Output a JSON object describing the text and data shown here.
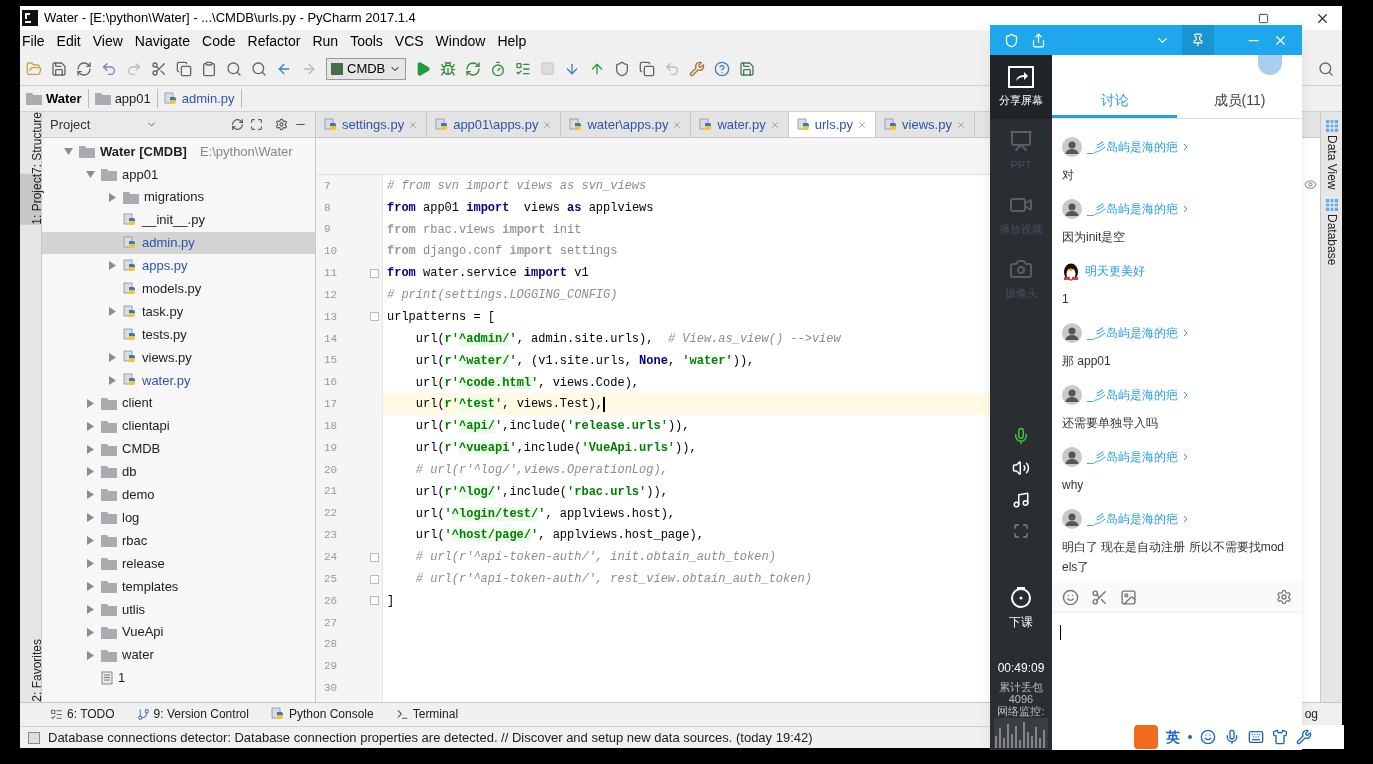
{
  "window": {
    "title": "Water - [E:\\python\\Water] - ...\\CMDB\\urls.py - PyCharm 2017.1.4"
  },
  "menu": [
    "File",
    "Edit",
    "View",
    "Navigate",
    "Code",
    "Refactor",
    "Run",
    "Tools",
    "VCS",
    "Window",
    "Help"
  ],
  "run_config": "CMDB",
  "breadcrumb": [
    {
      "label": "Water",
      "kind": "project"
    },
    {
      "label": "app01",
      "kind": "folder"
    },
    {
      "label": "admin.py",
      "kind": "python"
    }
  ],
  "side_tabs_left": [
    {
      "label": "7: Structure",
      "selected": false
    },
    {
      "label": "1: Project",
      "selected": true
    },
    {
      "label": "2: Favorites",
      "selected": false
    }
  ],
  "project_panel": {
    "title": "Project",
    "tree": [
      {
        "label": "Water [CMDB]",
        "path": "E:\\python\\Water",
        "kind": "project",
        "expanded": true,
        "selected": false,
        "changed": false,
        "children": [
          {
            "label": "app01",
            "kind": "folder",
            "expanded": true,
            "selected": false,
            "changed": false,
            "children": [
              {
                "label": "migrations",
                "kind": "folder",
                "expanded": false,
                "selected": false,
                "changed": false
              },
              {
                "label": "__init__.py",
                "kind": "python",
                "selected": false,
                "changed": false
              },
              {
                "label": "admin.py",
                "kind": "python",
                "selected": true,
                "changed": true
              },
              {
                "label": "apps.py",
                "kind": "python",
                "expanded": false,
                "selected": false,
                "changed": true
              },
              {
                "label": "models.py",
                "kind": "python",
                "selected": false,
                "changed": false
              },
              {
                "label": "task.py",
                "kind": "python",
                "expanded": false,
                "selected": false,
                "changed": false
              },
              {
                "label": "tests.py",
                "kind": "python",
                "selected": false,
                "changed": false
              },
              {
                "label": "views.py",
                "kind": "python",
                "expanded": false,
                "selected": false,
                "changed": false
              },
              {
                "label": "water.py",
                "kind": "python",
                "expanded": false,
                "selected": false,
                "changed": true
              }
            ]
          },
          {
            "label": "client",
            "kind": "folder",
            "expanded": false,
            "selected": false,
            "changed": false
          },
          {
            "label": "clientapi",
            "kind": "folder",
            "expanded": false,
            "selected": false,
            "changed": false
          },
          {
            "label": "CMDB",
            "kind": "folder",
            "expanded": false,
            "selected": false,
            "changed": false
          },
          {
            "label": "db",
            "kind": "folder",
            "expanded": false,
            "selected": false,
            "changed": false
          },
          {
            "label": "demo",
            "kind": "folder",
            "expanded": false,
            "selected": false,
            "changed": false
          },
          {
            "label": "log",
            "kind": "folder",
            "expanded": false,
            "selected": false,
            "changed": false
          },
          {
            "label": "rbac",
            "kind": "folder",
            "expanded": false,
            "selected": false,
            "changed": false
          },
          {
            "label": "release",
            "kind": "folder",
            "expanded": false,
            "selected": false,
            "changed": false
          },
          {
            "label": "templates",
            "kind": "folder",
            "expanded": false,
            "selected": false,
            "changed": false
          },
          {
            "label": "utlis",
            "kind": "folder",
            "expanded": false,
            "selected": false,
            "changed": false
          },
          {
            "label": "VueApi",
            "kind": "folder",
            "expanded": false,
            "selected": false,
            "changed": false
          },
          {
            "label": "water",
            "kind": "folder",
            "expanded": false,
            "selected": false,
            "changed": false
          },
          {
            "label": "1",
            "kind": "text",
            "selected": false,
            "changed": false
          }
        ]
      }
    ]
  },
  "editor_tabs": [
    {
      "label": "settings.py",
      "selected": false
    },
    {
      "label": "app01\\apps.py",
      "selected": false
    },
    {
      "label": "water\\apps.py",
      "selected": false
    },
    {
      "label": "water.py",
      "selected": false
    },
    {
      "label": "urls.py",
      "selected": true
    },
    {
      "label": "views.py",
      "selected": false
    }
  ],
  "code_lines": [
    {
      "number": "7",
      "current": false,
      "fold": false,
      "segments": [
        {
          "kind": "comment",
          "text": "# from svn import views as svn_views"
        }
      ]
    },
    {
      "number": "8",
      "current": false,
      "fold": false,
      "segments": [
        {
          "kind": "kw",
          "text": "from"
        },
        {
          "kind": "text",
          "text": " app01 "
        },
        {
          "kind": "kw",
          "text": "import"
        },
        {
          "kind": "text",
          "text": "  views "
        },
        {
          "kind": "kw",
          "text": "as"
        },
        {
          "kind": "text",
          "text": " applviews"
        }
      ]
    },
    {
      "number": "9",
      "current": false,
      "fold": false,
      "segments": [
        {
          "kind": "dimkw",
          "text": "from"
        },
        {
          "kind": "dim",
          "text": " rbac.views "
        },
        {
          "kind": "dimkw",
          "text": "import"
        },
        {
          "kind": "dim",
          "text": " init"
        }
      ]
    },
    {
      "number": "10",
      "current": false,
      "fold": false,
      "segments": [
        {
          "kind": "dimkw",
          "text": "from"
        },
        {
          "kind": "dim",
          "text": " django.conf "
        },
        {
          "kind": "dimkw",
          "text": "import"
        },
        {
          "kind": "dim",
          "text": " settings"
        }
      ]
    },
    {
      "number": "11",
      "current": false,
      "fold": true,
      "segments": [
        {
          "kind": "kw",
          "text": "from"
        },
        {
          "kind": "text",
          "text": " water.service "
        },
        {
          "kind": "kw",
          "text": "import"
        },
        {
          "kind": "text",
          "text": " v1"
        }
      ]
    },
    {
      "number": "12",
      "current": false,
      "fold": false,
      "segments": [
        {
          "kind": "comment",
          "text": "# print(settings.LOGGING_CONFIG)"
        }
      ]
    },
    {
      "number": "13",
      "current": false,
      "fold": true,
      "segments": [
        {
          "kind": "text",
          "text": "urlpatterns = ["
        }
      ]
    },
    {
      "number": "14",
      "current": false,
      "fold": false,
      "segments": [
        {
          "kind": "text",
          "text": "    url("
        },
        {
          "kind": "str",
          "text": "r'"
        },
        {
          "kind": "regex",
          "text": "^admin/"
        },
        {
          "kind": "str",
          "text": "'"
        },
        {
          "kind": "text",
          "text": ", admin.site.urls),  "
        },
        {
          "kind": "comment",
          "text": "# View.as_view() -->view"
        }
      ]
    },
    {
      "number": "15",
      "current": false,
      "fold": false,
      "segments": [
        {
          "kind": "text",
          "text": "    url("
        },
        {
          "kind": "str",
          "text": "r'"
        },
        {
          "kind": "regex",
          "text": "^water/"
        },
        {
          "kind": "str",
          "text": "'"
        },
        {
          "kind": "text",
          "text": ", (v1.site.urls, "
        },
        {
          "kind": "kw",
          "text": "None"
        },
        {
          "kind": "text",
          "text": ", "
        },
        {
          "kind": "str",
          "text": "'water'"
        },
        {
          "kind": "text",
          "text": ")),"
        }
      ]
    },
    {
      "number": "16",
      "current": false,
      "fold": false,
      "segments": [
        {
          "kind": "text",
          "text": "    url("
        },
        {
          "kind": "str",
          "text": "r'"
        },
        {
          "kind": "regex",
          "text": "^code.html"
        },
        {
          "kind": "str",
          "text": "'"
        },
        {
          "kind": "text",
          "text": ", views.Code),"
        }
      ]
    },
    {
      "number": "17",
      "current": true,
      "fold": false,
      "segments": [
        {
          "kind": "text",
          "text": "    url("
        },
        {
          "kind": "str",
          "text": "r'"
        },
        {
          "kind": "regex",
          "text": "^test"
        },
        {
          "kind": "str",
          "text": "'"
        },
        {
          "kind": "text",
          "text": ", views.Test),"
        }
      ]
    },
    {
      "number": "18",
      "current": false,
      "fold": false,
      "segments": [
        {
          "kind": "text",
          "text": "    url("
        },
        {
          "kind": "str",
          "text": "r'"
        },
        {
          "kind": "regex",
          "text": "^api/"
        },
        {
          "kind": "str",
          "text": "'"
        },
        {
          "kind": "text",
          "text": ",include("
        },
        {
          "kind": "str",
          "text": "'release.urls'"
        },
        {
          "kind": "text",
          "text": ")),"
        }
      ]
    },
    {
      "number": "19",
      "current": false,
      "fold": false,
      "segments": [
        {
          "kind": "text",
          "text": "    url("
        },
        {
          "kind": "str",
          "text": "r'"
        },
        {
          "kind": "regex",
          "text": "^vueapi"
        },
        {
          "kind": "str",
          "text": "'"
        },
        {
          "kind": "text",
          "text": ",include("
        },
        {
          "kind": "str",
          "text": "'VueApi.urls'"
        },
        {
          "kind": "text",
          "text": ")),"
        }
      ]
    },
    {
      "number": "20",
      "current": false,
      "fold": false,
      "segments": [
        {
          "kind": "comment",
          "text": "    # url(r'^log/',views.OperationLog),"
        }
      ]
    },
    {
      "number": "21",
      "current": false,
      "fold": false,
      "segments": [
        {
          "kind": "text",
          "text": "    url("
        },
        {
          "kind": "str",
          "text": "r'"
        },
        {
          "kind": "regex",
          "text": "^log/"
        },
        {
          "kind": "str",
          "text": "'"
        },
        {
          "kind": "text",
          "text": ",include("
        },
        {
          "kind": "str",
          "text": "'rbac.urls'"
        },
        {
          "kind": "text",
          "text": ")),"
        }
      ]
    },
    {
      "number": "22",
      "current": false,
      "fold": false,
      "segments": [
        {
          "kind": "text",
          "text": "    url("
        },
        {
          "kind": "str",
          "text": "'"
        },
        {
          "kind": "regex",
          "text": "^login/test/"
        },
        {
          "kind": "str",
          "text": "'"
        },
        {
          "kind": "text",
          "text": ", applviews.host),"
        }
      ]
    },
    {
      "number": "23",
      "current": false,
      "fold": false,
      "segments": [
        {
          "kind": "text",
          "text": "    url("
        },
        {
          "kind": "str",
          "text": "'"
        },
        {
          "kind": "regex",
          "text": "^host/page/"
        },
        {
          "kind": "str",
          "text": "'"
        },
        {
          "kind": "text",
          "text": ", applviews.host_page),"
        }
      ]
    },
    {
      "number": "24",
      "current": false,
      "fold": true,
      "segments": [
        {
          "kind": "comment",
          "text": "    # url(r'^api-token-auth/', init.obtain_auth_token)"
        }
      ]
    },
    {
      "number": "25",
      "current": false,
      "fold": true,
      "segments": [
        {
          "kind": "comment",
          "text": "    # url(r'^api-token-auth/', rest_view.obtain_auth_token)"
        }
      ]
    },
    {
      "number": "26",
      "current": false,
      "fold": true,
      "segments": [
        {
          "kind": "text",
          "text": "]"
        }
      ]
    },
    {
      "number": "27",
      "current": false,
      "fold": false
    },
    {
      "number": "28",
      "current": false,
      "fold": false
    },
    {
      "number": "29",
      "current": false,
      "fold": false
    },
    {
      "number": "30",
      "current": false,
      "fold": false
    }
  ],
  "right_side_tabs": [
    "Data View",
    "Database"
  ],
  "bottom_tools": [
    {
      "label": "6: TODO",
      "kind": "todo"
    },
    {
      "label": "9: Version Control",
      "kind": "vcs"
    },
    {
      "label": "Python Console",
      "kind": "console"
    },
    {
      "label": "Terminal",
      "kind": "terminal"
    },
    {
      "label": "og",
      "kind": "log"
    }
  ],
  "status_bar": "Database connections detector: Database connection properties are detected. // Discover and setup new data sources. (today 19:42)",
  "chat": {
    "side_items": [
      {
        "label": "分享屏幕",
        "kind": "share",
        "disabled": false
      },
      {
        "label": "PPT",
        "kind": "ppt",
        "disabled": true
      },
      {
        "label": "播放视频",
        "kind": "video",
        "disabled": true
      },
      {
        "label": "摄像头",
        "kind": "camera",
        "disabled": true
      }
    ],
    "end_button": "下课",
    "timer": "00:49:09",
    "packet_loss_label": "累计丢包",
    "packet_loss": "4096",
    "network_label": "网络监控:",
    "tabs": [
      {
        "label": "讨论",
        "selected": true
      },
      {
        "label": "成员(11)",
        "selected": false
      }
    ],
    "messages": [
      {
        "author": "_彡岛屿是海的疤",
        "kind": "photo",
        "text": "对"
      },
      {
        "author": "_彡岛屿是海的疤",
        "kind": "photo",
        "text": "因为init是空"
      },
      {
        "author": "明天更美好",
        "kind": "penguin",
        "text": "1"
      },
      {
        "author": "_彡岛屿是海的疤",
        "kind": "photo",
        "text": "那 app01"
      },
      {
        "author": "_彡岛屿是海的疤",
        "kind": "photo",
        "text": "还需要单独导入吗"
      },
      {
        "author": "_彡岛屿是海的疤",
        "kind": "photo",
        "text": "why"
      },
      {
        "author": "_彡岛屿是海的疤",
        "kind": "photo",
        "text": "明白了 现在是自动注册 所以不需要找models了"
      }
    ],
    "ime": "英"
  }
}
